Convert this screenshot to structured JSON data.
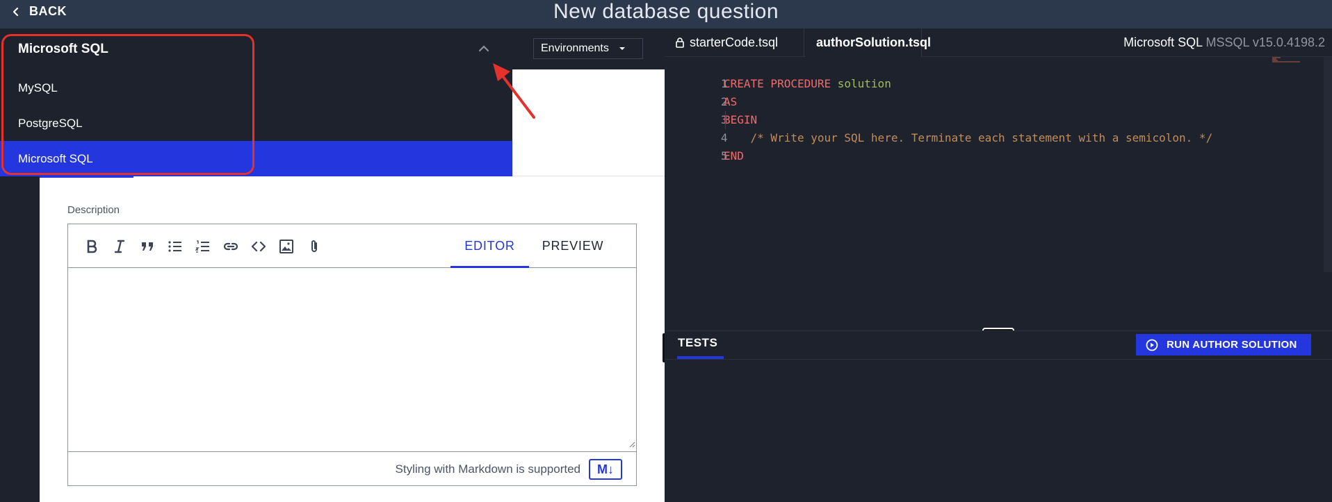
{
  "header": {
    "back_label": "BACK",
    "title": "New database question"
  },
  "language_dropdown": {
    "selected": "Microsoft SQL",
    "options": [
      "MySQL",
      "PostgreSQL",
      "Microsoft SQL"
    ],
    "active_index": 2
  },
  "environments": {
    "label": "Environments"
  },
  "description": {
    "label": "Description",
    "tabs": {
      "editor": "EDITOR",
      "preview": "PREVIEW"
    },
    "footer_text": "Styling with Markdown is supported",
    "toolbar_icons": [
      "bold-icon",
      "italic-icon",
      "quote-icon",
      "bullet-list-icon",
      "numbered-list-icon",
      "link-icon",
      "code-icon",
      "image-icon",
      "attachment-icon"
    ]
  },
  "code_editor": {
    "tabs": [
      {
        "label": "starterCode.tsql",
        "locked": true
      },
      {
        "label": "authorSolution.tsql",
        "active": true
      }
    ],
    "language_name": "Microsoft SQL",
    "language_version": "MSSQL v15.0.4198.2",
    "lines": [
      {
        "num": "1",
        "kw": "CREATE PROCEDURE",
        "fn": " solution"
      },
      {
        "num": "2",
        "kw": "AS"
      },
      {
        "num": "3",
        "kw": "BEGIN"
      },
      {
        "num": "4",
        "cm": "    /* Write your SQL here. Terminate each statement with a semicolon. */"
      },
      {
        "num": "5",
        "kw": "END"
      }
    ]
  },
  "tests": {
    "tab_label": "TESTS",
    "run_button": "RUN AUTHOR SOLUTION"
  },
  "colors": {
    "accent": "#2436de",
    "highlight": "#e5312b",
    "dark_bg": "#1e222c",
    "topbar": "#2c394d"
  }
}
